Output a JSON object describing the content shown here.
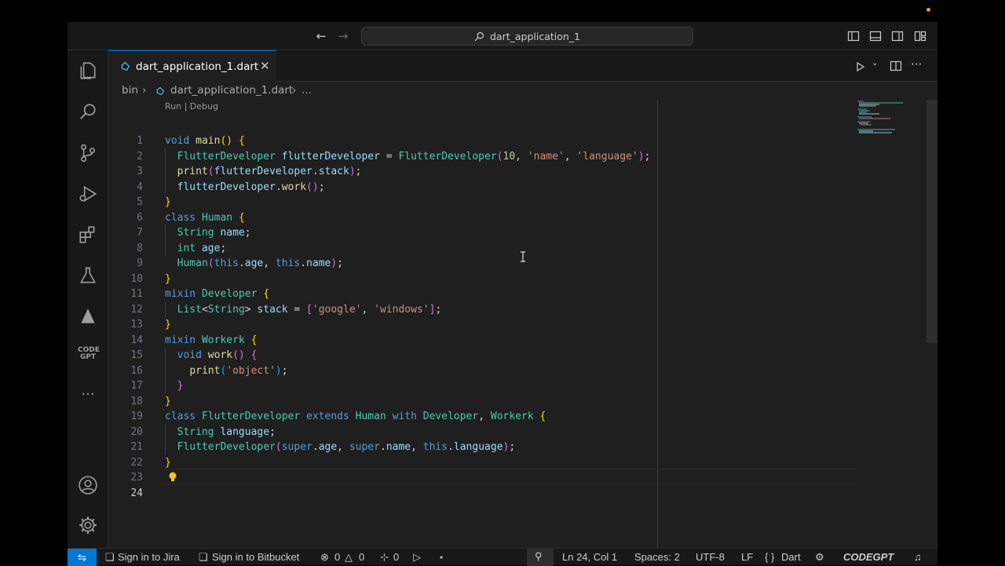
{
  "titlebar": {
    "search_text": "dart_application_1",
    "back_icon": "arrow-left-icon",
    "forward_icon": "arrow-right-icon"
  },
  "tab": {
    "label": "dart_application_1.dart",
    "icon": "dart-file-icon"
  },
  "breadcrumb": {
    "folder": "bin",
    "file": "dart_application_1.dart",
    "more": "..."
  },
  "codelens": "Run | Debug",
  "lines": [
    "1",
    "2",
    "3",
    "4",
    "5",
    "6",
    "7",
    "8",
    "9",
    "10",
    "11",
    "12",
    "13",
    "14",
    "15",
    "16",
    "17",
    "18",
    "19",
    "20",
    "21",
    "22",
    "23",
    "24"
  ],
  "active_line": "24",
  "status": {
    "jira": "Sign in to Jira",
    "bitbucket": "Sign in to Bitbucket",
    "errors": "0",
    "warnings": "0",
    "ports": "0",
    "position": "Ln 24, Col 1",
    "spaces": "Spaces: 2",
    "encoding": "UTF-8",
    "eol": "LF",
    "language": "Dart",
    "brand": "CODEGPT"
  },
  "colors": {
    "accent": "#0078d4",
    "keyword": "#569cd6",
    "type": "#4ec9b0",
    "function": "#dcdcaa",
    "string": "#ce9178",
    "number": "#b5cea8"
  }
}
